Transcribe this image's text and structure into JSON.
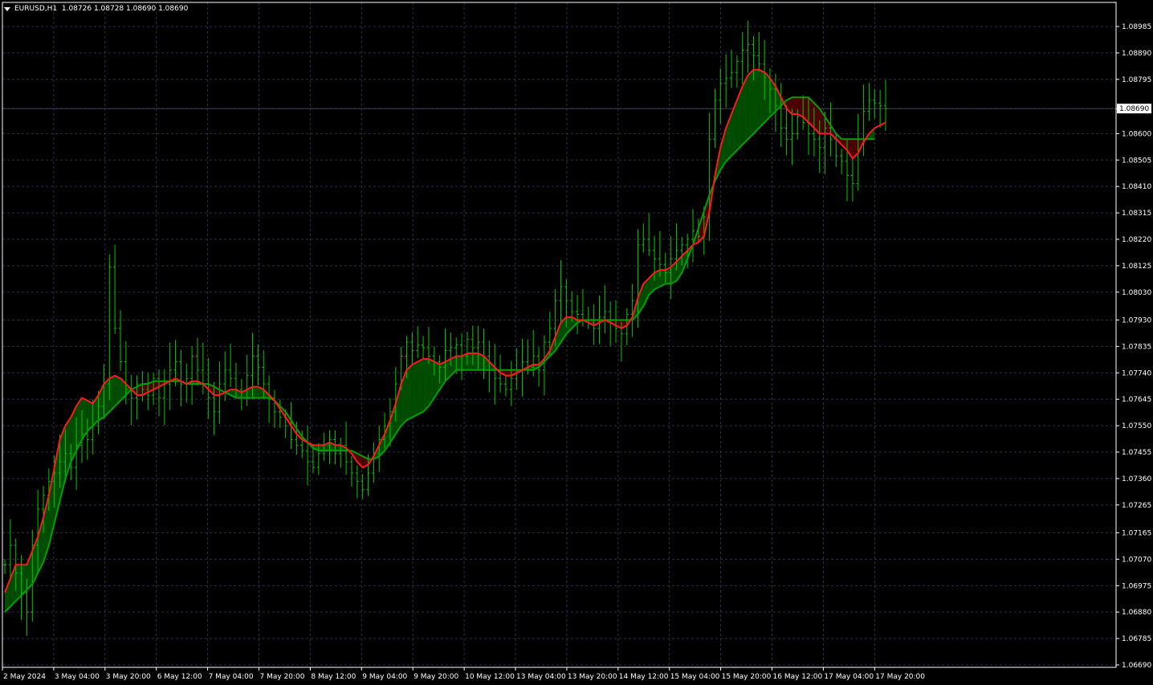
{
  "header": {
    "symbol": "EURUSD,H1",
    "ohlc": "1.08726 1.08728 1.08690 1.08690"
  },
  "colors": {
    "background": "#000000",
    "grid": "#2a2f45",
    "axis": "#ffffff",
    "bars": "#00c800",
    "fast_line": "#ff1a1a",
    "slow_line": "#00a000",
    "bull_fill": "#004d00",
    "bear_fill": "#4d0000",
    "price_line": "#3a3f5a"
  },
  "chart_data": {
    "type": "line",
    "title": "EURUSD,H1",
    "y_ticks": [
      "1.08985",
      "1.08890",
      "1.08795",
      "1.08690",
      "1.08600",
      "1.08505",
      "1.08410",
      "1.08315",
      "1.08220",
      "1.08125",
      "1.08030",
      "1.07930",
      "1.07835",
      "1.07740",
      "1.07645",
      "1.07550",
      "1.07455",
      "1.07360",
      "1.07265",
      "1.07165",
      "1.07070",
      "1.06975",
      "1.06880",
      "1.06785",
      "1.06690"
    ],
    "current_price": "1.08690",
    "ylim": [
      1.0669,
      1.08985
    ],
    "x_ticks": [
      "2 May 2024",
      "3 May 04:00",
      "3 May 20:00",
      "6 May 12:00",
      "7 May 04:00",
      "7 May 20:00",
      "8 May 12:00",
      "9 May 04:00",
      "9 May 20:00",
      "10 May 12:00",
      "13 May 04:00",
      "13 May 20:00",
      "14 May 12:00",
      "15 May 04:00",
      "15 May 20:00",
      "16 May 12:00",
      "17 May 04:00",
      "17 May 20:00"
    ],
    "grid": true,
    "closes": [
      1.0705,
      1.0712,
      1.0702,
      1.0695,
      1.0688,
      1.0712,
      1.0725,
      1.073,
      1.0735,
      1.0738,
      1.0742,
      1.0745,
      1.074,
      1.0748,
      1.0752,
      1.075,
      1.0755,
      1.0762,
      1.077,
      1.0812,
      1.079,
      1.0778,
      1.0768,
      1.0765,
      1.077,
      1.0768,
      1.0766,
      1.0772,
      1.0765,
      1.077,
      1.0775,
      1.0778,
      1.077,
      1.0772,
      1.078,
      1.0775,
      1.077,
      1.0765,
      1.076,
      1.077,
      1.0775,
      1.0772,
      1.0768,
      1.0765,
      1.0773,
      1.078,
      1.0776,
      1.077,
      1.0765,
      1.076,
      1.0758,
      1.0755,
      1.075,
      1.0748,
      1.0746,
      1.0742,
      1.074,
      1.0745,
      1.0748,
      1.075,
      1.0745,
      1.0748,
      1.0742,
      1.0738,
      1.0735,
      1.0732,
      1.0738,
      1.0745,
      1.075,
      1.0755,
      1.076,
      1.077,
      1.078,
      1.0785,
      1.0782,
      1.0784,
      1.0783,
      1.078,
      1.0778,
      1.0776,
      1.0782,
      1.0783,
      1.0784,
      1.078,
      1.0786,
      1.0783,
      1.0785,
      1.078,
      1.0775,
      1.0772,
      1.077,
      1.0768,
      1.0772,
      1.0775,
      1.0778,
      1.0776,
      1.078,
      1.0775,
      1.0785,
      1.079,
      1.08,
      1.0805,
      1.08,
      1.0796,
      1.0795,
      1.0793,
      1.0792,
      1.079,
      1.0794,
      1.0796,
      1.0793,
      1.079,
      1.0788,
      1.0795,
      1.08,
      1.082,
      1.0822,
      1.0818,
      1.0815,
      1.0813,
      1.081,
      1.0815,
      1.0818,
      1.082,
      1.0822,
      1.0825,
      1.0823,
      1.083,
      1.0858,
      1.0872,
      1.0878,
      1.088,
      1.0882,
      1.0886,
      1.089,
      1.0892,
      1.0888,
      1.0885,
      1.088,
      1.0876,
      1.087,
      1.0862,
      1.0858,
      1.086,
      1.0866,
      1.0864,
      1.086,
      1.0858,
      1.0855,
      1.0862,
      1.0858,
      1.0852,
      1.085,
      1.0845,
      1.0842,
      1.0858,
      1.0868,
      1.0872,
      1.0871,
      1.087,
      1.0869
    ]
  },
  "indicator": {
    "fast": [
      1.0695,
      1.07,
      1.0705,
      1.0705,
      1.0705,
      1.071,
      1.0715,
      1.0722,
      1.073,
      1.074,
      1.075,
      1.0755,
      1.0758,
      1.0762,
      1.0765,
      1.0764,
      1.0763,
      1.0766,
      1.077,
      1.0772,
      1.0773,
      1.0772,
      1.077,
      1.0768,
      1.0766,
      1.0766,
      1.0767,
      1.0768,
      1.0769,
      1.077,
      1.0771,
      1.0772,
      1.0771,
      1.077,
      1.0771,
      1.0771,
      1.077,
      1.0768,
      1.0766,
      1.0766,
      1.0767,
      1.0768,
      1.0768,
      1.0767,
      1.0768,
      1.0769,
      1.0769,
      1.0768,
      1.0766,
      1.0764,
      1.0761,
      1.0758,
      1.0755,
      1.0752,
      1.075,
      1.0749,
      1.0748,
      1.0748,
      1.0748,
      1.0749,
      1.0748,
      1.0748,
      1.0747,
      1.0745,
      1.0742,
      1.074,
      1.0741,
      1.0744,
      1.0748,
      1.0752,
      1.0757,
      1.0763,
      1.077,
      1.0775,
      1.0777,
      1.0778,
      1.0779,
      1.0779,
      1.0778,
      1.0777,
      1.0778,
      1.0779,
      1.078,
      1.078,
      1.0781,
      1.0781,
      1.0781,
      1.078,
      1.0778,
      1.0776,
      1.0774,
      1.0773,
      1.0773,
      1.0774,
      1.0775,
      1.0776,
      1.0777,
      1.0777,
      1.0779,
      1.0782,
      1.0787,
      1.0792,
      1.0794,
      1.0794,
      1.0793,
      1.0793,
      1.0792,
      1.0791,
      1.0792,
      1.0793,
      1.0792,
      1.0791,
      1.079,
      1.0791,
      1.0794,
      1.0801,
      1.0806,
      1.0808,
      1.081,
      1.0811,
      1.0811,
      1.0812,
      1.0814,
      1.0816,
      1.0818,
      1.082,
      1.0821,
      1.0823,
      1.0832,
      1.0845,
      1.0855,
      1.0862,
      1.0867,
      1.0872,
      1.0877,
      1.0881,
      1.0883,
      1.0883,
      1.0882,
      1.088,
      1.0877,
      1.0873,
      1.0869,
      1.0867,
      1.0867,
      1.0866,
      1.0864,
      1.0862,
      1.086,
      1.086,
      1.086,
      1.0858,
      1.0856,
      1.0854,
      1.0851,
      1.0853,
      1.0857,
      1.086,
      1.0862,
      1.0863,
      1.0864
    ],
    "slow": [
      1.0688,
      1.069,
      1.0692,
      1.0694,
      1.0696,
      1.0698,
      1.0702,
      1.0706,
      1.0712,
      1.072,
      1.0728,
      1.0736,
      1.0742,
      1.0746,
      1.075,
      1.0753,
      1.0755,
      1.0757,
      1.0758,
      1.076,
      1.0762,
      1.0764,
      1.0766,
      1.0768,
      1.0769,
      1.077,
      1.077,
      1.0771,
      1.0771,
      1.0771,
      1.0771,
      1.0771,
      1.0771,
      1.077,
      1.077,
      1.077,
      1.077,
      1.077,
      1.0769,
      1.0768,
      1.0767,
      1.0766,
      1.0765,
      1.0765,
      1.0765,
      1.0765,
      1.0765,
      1.0765,
      1.0765,
      1.0764,
      1.0762,
      1.076,
      1.0757,
      1.0754,
      1.0751,
      1.0749,
      1.0747,
      1.0746,
      1.0746,
      1.0746,
      1.0746,
      1.0746,
      1.0746,
      1.0746,
      1.0745,
      1.0744,
      1.0743,
      1.0743,
      1.0744,
      1.0746,
      1.0749,
      1.0752,
      1.0755,
      1.0757,
      1.0758,
      1.0759,
      1.076,
      1.0762,
      1.0765,
      1.0768,
      1.0771,
      1.0773,
      1.0775,
      1.0775,
      1.0775,
      1.0775,
      1.0775,
      1.0775,
      1.0775,
      1.0775,
      1.0775,
      1.0775,
      1.0775,
      1.0775,
      1.0775,
      1.0775,
      1.0775,
      1.0776,
      1.0778,
      1.078,
      1.0782,
      1.0785,
      1.0788,
      1.079,
      1.0792,
      1.0793,
      1.0793,
      1.0793,
      1.0793,
      1.0793,
      1.0793,
      1.0793,
      1.0793,
      1.0793,
      1.0793,
      1.0795,
      1.0798,
      1.0802,
      1.0804,
      1.0805,
      1.0806,
      1.0806,
      1.0807,
      1.081,
      1.0815,
      1.082,
      1.0826,
      1.0832,
      1.0838,
      1.0843,
      1.0847,
      1.085,
      1.0852,
      1.0854,
      1.0856,
      1.0858,
      1.086,
      1.0862,
      1.0864,
      1.0866,
      1.0868,
      1.087,
      1.0872,
      1.0873,
      1.0873,
      1.0873,
      1.0873,
      1.0871,
      1.0869,
      1.0866,
      1.0863,
      1.086,
      1.0858,
      1.0858,
      1.0858,
      1.0858,
      1.0858,
      1.0858,
      1.0858
    ]
  }
}
